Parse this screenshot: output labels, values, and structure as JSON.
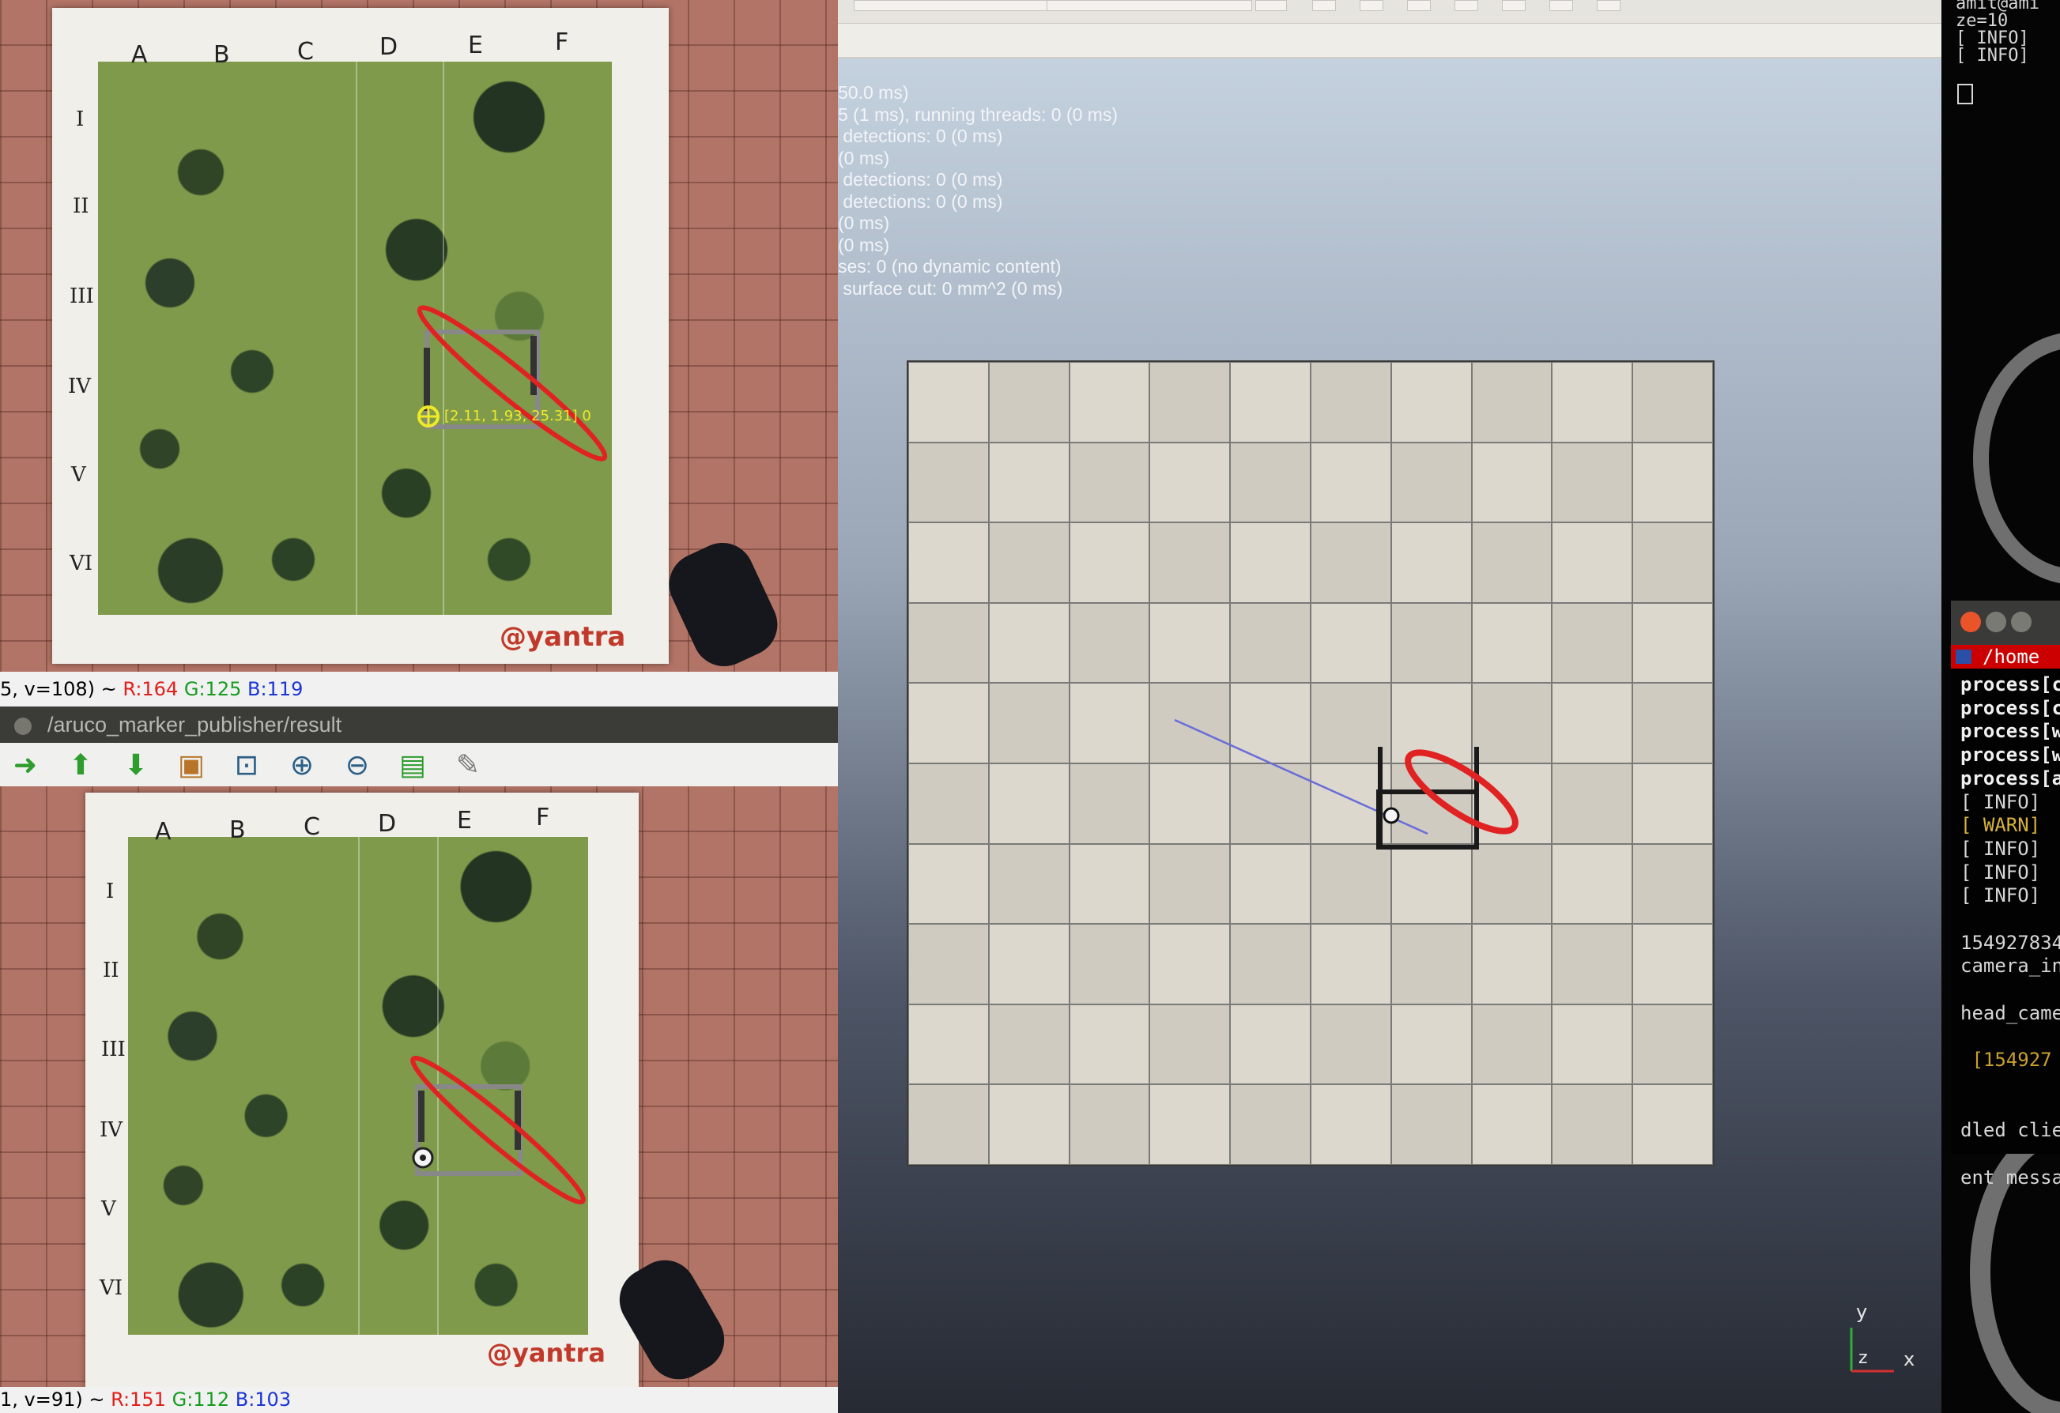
{
  "camera_top": {
    "columns": [
      "A",
      "B",
      "C",
      "D",
      "E",
      "F"
    ],
    "rows": [
      "I",
      "II",
      "III",
      "IV",
      "V",
      "VI"
    ],
    "brand": "@yantra",
    "marker_label": "[2.11, 1.93, 25.31] 0",
    "status_prefix": "5, v=108) ~ ",
    "r": "R:164",
    "g": "G:125",
    "b": "B:119"
  },
  "window_title": "/aruco_marker_publisher/result",
  "toolbar": {
    "items": [
      {
        "name": "forward-arrow-icon",
        "glyph": "➜",
        "color": "#2e9d2e"
      },
      {
        "name": "up-arrow-icon",
        "glyph": "⬆",
        "color": "#2e9d2e"
      },
      {
        "name": "down-arrow-icon",
        "glyph": "⬇",
        "color": "#2e9d2e"
      },
      {
        "name": "image-icon",
        "glyph": "▣",
        "color": "#b8752a"
      },
      {
        "name": "zoom-fit-icon",
        "glyph": "⊡",
        "color": "#2b5f86"
      },
      {
        "name": "zoom-in-icon",
        "glyph": "⊕",
        "color": "#2b5f86"
      },
      {
        "name": "zoom-out-icon",
        "glyph": "⊖",
        "color": "#2b5f86"
      },
      {
        "name": "save-icon",
        "glyph": "▤",
        "color": "#2e9d2e"
      },
      {
        "name": "brush-icon",
        "glyph": "✎",
        "color": "#777777"
      }
    ]
  },
  "camera_bottom": {
    "columns": [
      "A",
      "B",
      "C",
      "D",
      "E",
      "F"
    ],
    "rows": [
      "I",
      "II",
      "III",
      "IV",
      "V",
      "VI"
    ],
    "brand": "@yantra",
    "status_prefix": "1, v=91) ~ ",
    "r": "R:151",
    "g": "G:112",
    "b": "B:103"
  },
  "rviz": {
    "stats_lines": [
      "50.0 ms)",
      "5 (1 ms), running threads: 0 (0 ms)",
      " detections: 0 (0 ms)",
      "(0 ms)",
      " detections: 0 (0 ms)",
      " detections: 0 (0 ms)",
      "(0 ms)",
      "(0 ms)",
      "ses: 0 (no dynamic content)",
      " surface cut: 0 mm^2 (0 ms)"
    ],
    "axis_labels": {
      "y": "y",
      "z": "z",
      "x": "x"
    }
  },
  "terminal": {
    "top_lines": [
      "amit@ami",
      "ze=10",
      "[ INFO]",
      "[ INFO]"
    ],
    "path_title": "/home",
    "lines": [
      {
        "text": "process[c",
        "style": "bold"
      },
      {
        "text": "process[c",
        "style": "bold"
      },
      {
        "text": "process[w",
        "style": "bold"
      },
      {
        "text": "process[w",
        "style": "bold"
      },
      {
        "text": "process[a",
        "style": "bold"
      },
      {
        "text": "[ INFO]",
        "style": ""
      },
      {
        "text": "[ WARN]",
        "style": "warn"
      },
      {
        "text": "[ INFO]",
        "style": ""
      },
      {
        "text": "[ INFO]",
        "style": ""
      },
      {
        "text": "[ INFO]",
        "style": ""
      },
      {
        "text": "",
        "style": ""
      },
      {
        "text": "154927834",
        "style": ""
      },
      {
        "text": "camera_in",
        "style": ""
      },
      {
        "text": "",
        "style": ""
      },
      {
        "text": "head_came",
        "style": ""
      },
      {
        "text": "",
        "style": ""
      },
      {
        "text": " [154927",
        "style": "y"
      },
      {
        "text": "",
        "style": ""
      },
      {
        "text": "",
        "style": ""
      },
      {
        "text": "dled clie",
        "style": ""
      },
      {
        "text": "",
        "style": ""
      },
      {
        "text": "ent messa",
        "style": ""
      }
    ]
  },
  "colors": {
    "marker_ring": "#e02222",
    "marker_text": "#f0e92a",
    "axis_x": "#d43030",
    "axis_y": "#2fae3c",
    "axis_z": "#3550d8",
    "trajectory": "#6a6cd8"
  }
}
